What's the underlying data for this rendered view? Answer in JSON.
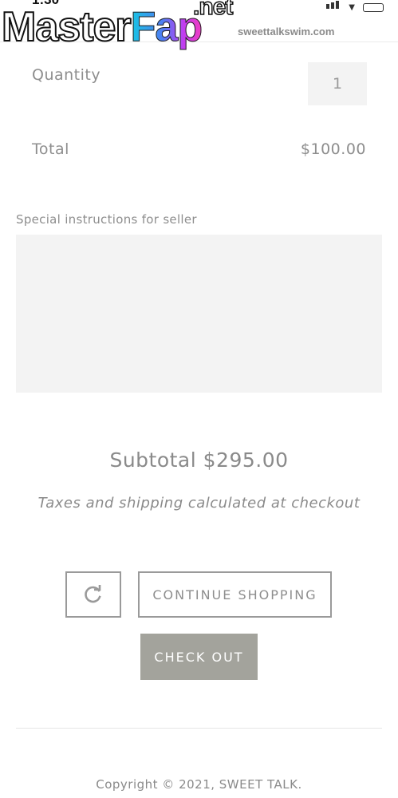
{
  "status_bar": {
    "time": "1:30"
  },
  "watermark": {
    "master": "Master",
    "fap": "Fap",
    "net": ".net"
  },
  "url_bar": {
    "text": "sweettalkswim.com"
  },
  "cart": {
    "quantity_label": "Quantity",
    "quantity_value": "1",
    "total_label": "Total",
    "total_value": "$100.00",
    "instructions_label": "Special instructions for seller",
    "instructions_value": "",
    "subtotal_text": "Subtotal $295.00",
    "tax_note": "Taxes and shipping calculated at checkout"
  },
  "actions": {
    "update_icon": "refresh-icon",
    "continue_label": "CONTINUE SHOPPING",
    "checkout_label": "CHECK OUT"
  },
  "footer": {
    "copyright": "Copyright © 2021, SWEET TALK."
  },
  "colors": {
    "text_gray": "#8e8e8e",
    "field_bg": "#f3f3f3",
    "checkout_bg": "#a3a39c",
    "border_gray": "#9a9a9a"
  }
}
